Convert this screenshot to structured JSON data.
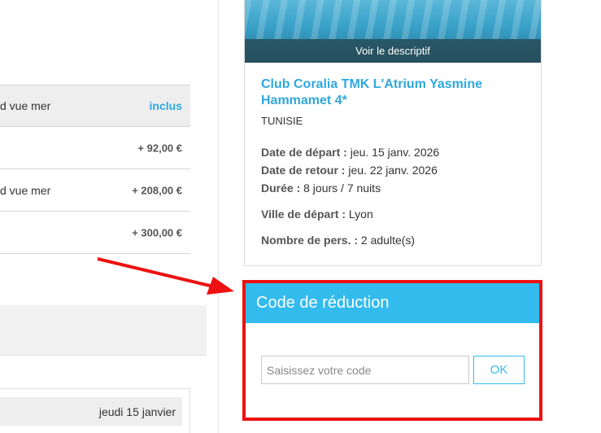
{
  "options": [
    {
      "label": "d vue mer",
      "price": "inclus"
    },
    {
      "label": "",
      "price": "+ 92,00 €"
    },
    {
      "label": "d vue mer",
      "price": "+ 208,00 €"
    },
    {
      "label": "",
      "price": "+ 300,00 €"
    }
  ],
  "date_chip": "jeudi 15 janvier",
  "hotel": {
    "photo_caption": "Voir le descriptif",
    "name": "Club Coralia TMK L'Atrium Yasmine Hammamet 4*",
    "country": "TUNISIE",
    "depart_label": "Date de départ :",
    "depart_value": "jeu. 15 janv. 2026",
    "retour_label": "Date de retour :",
    "retour_value": "jeu. 22 janv. 2026",
    "duree_label": "Durée :",
    "duree_value": "8 jours / 7 nuits",
    "ville_label": "Ville de départ :",
    "ville_value": "Lyon",
    "pers_label": "Nombre de pers. :",
    "pers_value": "2 adulte(s)"
  },
  "promo": {
    "title": "Code de réduction",
    "placeholder": "Saisissez votre code",
    "value": "",
    "ok_label": "OK"
  },
  "colors": {
    "accent": "#33bbee",
    "highlight_frame": "#ee1111"
  }
}
